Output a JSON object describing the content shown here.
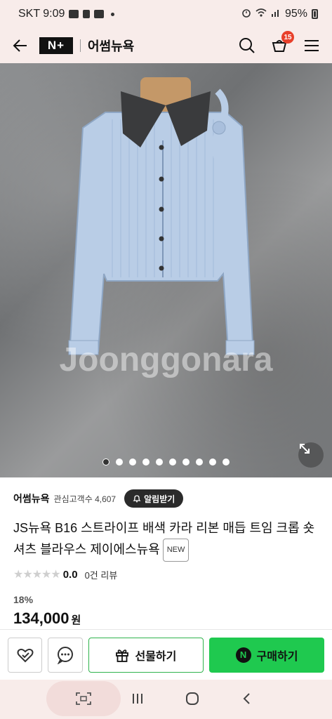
{
  "status_bar": {
    "carrier_time": "SKT 9:09",
    "battery": "95%"
  },
  "header": {
    "logo": "N+",
    "store_name": "어썸뉴욕",
    "cart_count": "15",
    "icons": [
      "back-arrow-icon",
      "search-icon",
      "cart-icon",
      "menu-icon"
    ]
  },
  "gallery": {
    "watermark": "Joonggonara",
    "image_count": 10,
    "active_index": 0
  },
  "seller": {
    "name": "어썸뉴욕",
    "followers": "관심고객수 4,607",
    "notify_label": "알림받기"
  },
  "product": {
    "title": "JS뉴욕 B16 스트라이프 배색 카라 리본 매듭 트임 크롭 숏 셔츠 블라우스 제이에스뉴욕",
    "new_badge": "NEW",
    "rating": "0.0",
    "reviews": "0건 리뷰",
    "discount": "18%",
    "price": "134,000",
    "currency": "원"
  },
  "actions": {
    "gift_label": "선물하기",
    "buy_label": "구매하기",
    "npay_mark": "N"
  },
  "colors": {
    "header_bg": "#f8ecea",
    "buy_green": "#1fc94f",
    "badge_red": "#e8402b"
  }
}
